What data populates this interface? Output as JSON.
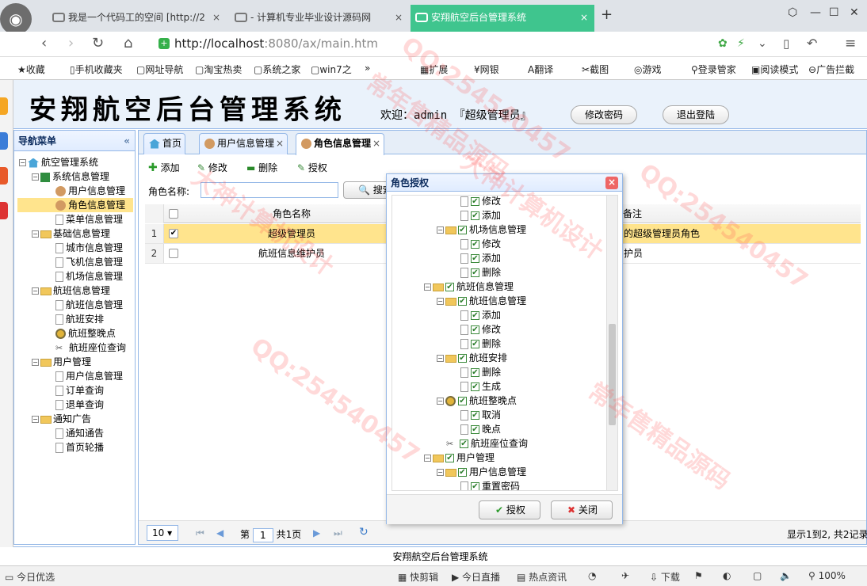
{
  "browser": {
    "tabs": [
      {
        "label": "我是一个代码工的空间 [http://2",
        "close": "×"
      },
      {
        "label": "- 计算机专业毕业设计源码网",
        "close": "×"
      },
      {
        "label": "安翔航空后台管理系统",
        "close": "×"
      }
    ],
    "url_host": "http://localhost",
    "url_rest": ":8080/ax/main.htm",
    "bookmarks": [
      "收藏",
      "手机收藏夹",
      "网址导航",
      "淘宝热卖",
      "系统之家",
      "win7之",
      "»",
      "扩展",
      "网银",
      "翻译",
      "截图",
      "游戏",
      "登录管家",
      "阅读模式",
      "广告拦截"
    ]
  },
  "header": {
    "title": "安翔航空后台管理系统",
    "welcome": "欢迎：admin 『超级管理员』",
    "change_pwd": "修改密码",
    "logout": "退出登陆"
  },
  "sidebar": {
    "title": "导航菜单",
    "collapse": "«",
    "nodes": [
      "航空管理系统",
      "系统信息管理",
      "用户信息管理",
      "角色信息管理",
      "菜单信息管理",
      "基础信息管理",
      "城市信息管理",
      "飞机信息管理",
      "机场信息管理",
      "航班信息管理",
      "航班信息管理",
      "航班安排",
      "航班整晚点",
      "航班座位查询",
      "用户管理",
      "用户信息管理",
      "订单查询",
      "退单查询",
      "通知广告",
      "通知通告",
      "首页轮播"
    ]
  },
  "main": {
    "tabs": [
      "首页",
      "用户信息管理",
      "角色信息管理"
    ],
    "tab_close": "×",
    "toolbar": {
      "add": "添加",
      "edit": "修改",
      "delete": "删除",
      "auth": "授权"
    },
    "search_label": "角色名称:",
    "search_btn": "搜索",
    "columns": {
      "name": "角色名称",
      "remark": "备注"
    },
    "rows": [
      {
        "no": "1",
        "checked": "✔",
        "name": "超级管理员",
        "remark": "的超级管理员角色"
      },
      {
        "no": "2",
        "checked": "",
        "name": "航班信息维护员",
        "remark": "护员"
      }
    ],
    "pager": {
      "size": "10",
      "page_prefix": "第",
      "page": "1",
      "page_suffix": "共1页",
      "info": "显示1到2, 共2记录"
    }
  },
  "footer": "安翔航空后台管理系统",
  "statusbar": [
    "今日优选",
    "快剪辑",
    "今日直播",
    "热点资讯",
    "下载",
    "100%"
  ],
  "dialog": {
    "title": "角色授权",
    "close": "×",
    "nodes": [
      "修改",
      "添加",
      "机场信息管理",
      "修改",
      "添加",
      "删除",
      "航班信息管理",
      "航班信息管理",
      "添加",
      "修改",
      "删除",
      "航班安排",
      "删除",
      "生成",
      "航班整晚点",
      "取消",
      "晚点",
      "航班座位查询",
      "用户管理",
      "用户信息管理",
      "重置密码"
    ],
    "check": "✔",
    "auth_btn": "授权",
    "close_btn": "关闭"
  },
  "watermarks": [
    "QQ:254540457",
    "大神计算机设计",
    "常年售精品源码"
  ]
}
